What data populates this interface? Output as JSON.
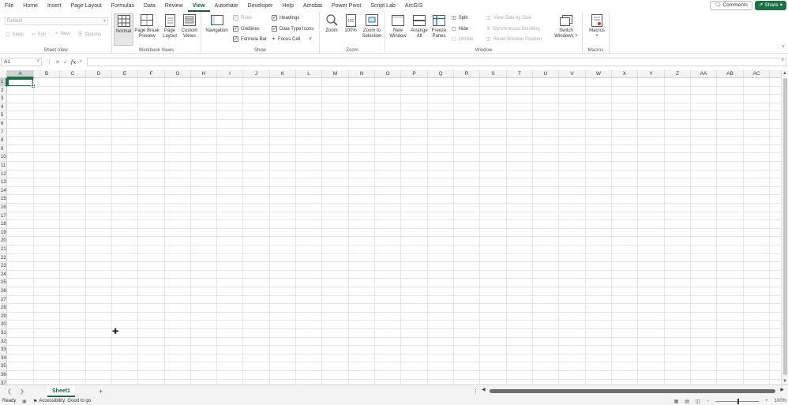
{
  "menu": {
    "items": [
      "File",
      "Home",
      "Insert",
      "Page Layout",
      "Formulas",
      "Data",
      "Review",
      "View",
      "Automate",
      "Developer",
      "Help",
      "Acrobat",
      "Power Pivot",
      "Script Lab",
      "ArcGIS"
    ],
    "active": "View",
    "comments_label": "Comments",
    "share_label": "Share"
  },
  "ribbon": {
    "sheet_view": {
      "dropdown_value": "Default",
      "keep": "Keep",
      "exit": "Exit",
      "new": "New",
      "options": "Options",
      "label": "Sheet View"
    },
    "workbook_views": {
      "normal": "Normal",
      "page_break_preview_1": "Page Break",
      "page_break_preview_2": "Preview",
      "page_layout_1": "Page",
      "page_layout_2": "Layout",
      "custom_views_1": "Custom",
      "custom_views_2": "Views",
      "label": "Workbook Views"
    },
    "show": {
      "navigation": "Navigation",
      "ruler": "Ruler",
      "gridlines": "Gridlines",
      "formula_bar": "Formula Bar",
      "headings": "Headings",
      "data_type_icons": "Data Type Icons",
      "focus_cell": "Focus Cell",
      "label": "Show"
    },
    "zoom": {
      "zoom": "Zoom",
      "hundred": "100%",
      "zoom_sel_1": "Zoom to",
      "zoom_sel_2": "Selection",
      "label": "Zoom"
    },
    "window": {
      "new_window_1": "New",
      "new_window_2": "Window",
      "arrange_all_1": "Arrange",
      "arrange_all_2": "All",
      "freeze_panes_1": "Freeze",
      "freeze_panes_2": "Panes",
      "split": "Split",
      "hide": "Hide",
      "unhide": "Unhide",
      "view_side_by_side": "View Side by Side",
      "sync_scrolling": "Synchronous Scrolling",
      "reset_window_position": "Reset Window Position",
      "switch_windows_1": "Switch",
      "switch_windows_2": "Windows",
      "label": "Window"
    },
    "macros": {
      "macros": "Macros",
      "label": "Macros"
    }
  },
  "formula_bar": {
    "name_box": "A1",
    "fx": "fx",
    "value": ""
  },
  "grid": {
    "columns": [
      "A",
      "B",
      "C",
      "D",
      "E",
      "F",
      "G",
      "H",
      "I",
      "J",
      "K",
      "L",
      "M",
      "N",
      "O",
      "P",
      "Q",
      "R",
      "S",
      "T",
      "U",
      "V",
      "W",
      "X",
      "Y",
      "Z",
      "AA",
      "AB",
      "AC"
    ],
    "rows": [
      "1",
      "2",
      "3",
      "4",
      "5",
      "6",
      "7",
      "8",
      "9",
      "10",
      "11",
      "12",
      "13",
      "14",
      "15",
      "16",
      "17",
      "18",
      "19",
      "20",
      "21",
      "22",
      "23",
      "24",
      "25",
      "26",
      "27",
      "28",
      "29",
      "30",
      "31",
      "32",
      "33",
      "34",
      "35",
      "36",
      "37"
    ],
    "active_cell": "A1"
  },
  "sheets": {
    "tabs": [
      "Sheet1"
    ],
    "active": "Sheet1"
  },
  "status": {
    "ready": "Ready",
    "accessibility": "Accessibility: Good to go",
    "zoom": "100%"
  }
}
